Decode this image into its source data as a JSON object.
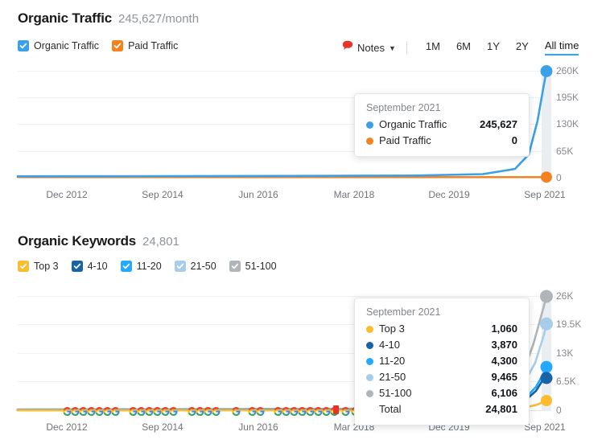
{
  "colors": {
    "organic_traffic": "#3ba0e8",
    "paid_traffic": "#f58220",
    "top3": "#fbbc2e",
    "r4_10": "#1763a6",
    "r11_20": "#25a9ff",
    "r21_50": "#a8cdeb",
    "r51_100": "#b0b5b9",
    "accent": "#25a9ff",
    "notes_red": "#e8352c",
    "grid": "#eef1f3",
    "axis_text": "#85898e"
  },
  "traffic_section": {
    "title": "Organic Traffic",
    "value": "245,627/month",
    "legend": [
      {
        "label": "Organic Traffic",
        "color": "#3ba0e8",
        "checked": true,
        "icon": "checkbox-checked-icon"
      },
      {
        "label": "Paid Traffic",
        "color": "#f58220",
        "checked": true,
        "icon": "checkbox-checked-icon"
      }
    ],
    "controls": {
      "notes_label": "Notes",
      "notes_icon": "speech-bubble-icon",
      "chevron_icon": "chevron-down-icon",
      "ranges": [
        {
          "label": "1M",
          "active": false
        },
        {
          "label": "6M",
          "active": false
        },
        {
          "label": "1Y",
          "active": false
        },
        {
          "label": "2Y",
          "active": false
        },
        {
          "label": "All time",
          "active": true
        }
      ]
    },
    "tooltip": {
      "date": "September 2021",
      "rows": [
        {
          "name": "Organic Traffic",
          "value": "245,627",
          "color": "#3ba0e8"
        },
        {
          "name": "Paid Traffic",
          "value": "0",
          "color": "#f58220"
        }
      ]
    }
  },
  "keywords_section": {
    "title": "Organic Keywords",
    "value": "24,801",
    "legend": [
      {
        "label": "Top 3",
        "color": "#fbbc2e",
        "checked": true,
        "icon": "checkbox-checked-icon"
      },
      {
        "label": "4-10",
        "color": "#1763a6",
        "checked": true,
        "icon": "checkbox-checked-icon"
      },
      {
        "label": "11-20",
        "color": "#25a9ff",
        "checked": true,
        "icon": "checkbox-checked-icon"
      },
      {
        "label": "21-50",
        "color": "#a8cdeb",
        "checked": true,
        "icon": "checkbox-checked-icon"
      },
      {
        "label": "51-100",
        "color": "#b0b5b9",
        "checked": true,
        "icon": "checkbox-checked-icon"
      }
    ],
    "tooltip": {
      "date": "September 2021",
      "rows": [
        {
          "name": "Top 3",
          "value": "1,060",
          "color": "#fbbc2e"
        },
        {
          "name": "4-10",
          "value": "3,870",
          "color": "#1763a6"
        },
        {
          "name": "11-20",
          "value": "4,300",
          "color": "#25a9ff"
        },
        {
          "name": "21-50",
          "value": "9,465",
          "color": "#a8cdeb"
        },
        {
          "name": "51-100",
          "value": "6,106",
          "color": "#b0b5b9"
        }
      ],
      "total_label": "Total",
      "total_value": "24,801"
    }
  },
  "chart_data": [
    {
      "id": "organic-traffic-chart",
      "type": "line",
      "title": "Organic Traffic",
      "xlabel": "",
      "ylabel": "",
      "ylim": [
        0,
        260000
      ],
      "yticks": [
        0,
        65000,
        130000,
        195000,
        260000
      ],
      "ytick_labels": [
        "0",
        "65K",
        "130K",
        "195K",
        "260K"
      ],
      "xtick_labels": [
        "Dec 2012",
        "Sep 2014",
        "Jun 2016",
        "Mar 2018",
        "Dec 2019",
        "Sep 2021"
      ],
      "grid": true,
      "legend_position": "top-left",
      "highlight_x": "Sep 2021",
      "series": [
        {
          "name": "Organic Traffic",
          "color": "#3ba0e8",
          "x": [
            "Dec 2012",
            "Sep 2014",
            "Jun 2016",
            "Mar 2018",
            "Dec 2019",
            "Jun 2021",
            "Aug 2021",
            "Sep 2021"
          ],
          "values": [
            500,
            600,
            700,
            900,
            1500,
            9000,
            70000,
            245627
          ],
          "end_value": 245627
        },
        {
          "name": "Paid Traffic",
          "color": "#f58220",
          "x": [
            "Dec 2012",
            "Sep 2014",
            "Jun 2016",
            "Mar 2018",
            "Dec 2019",
            "Jun 2021",
            "Aug 2021",
            "Sep 2021"
          ],
          "values": [
            0,
            0,
            0,
            0,
            0,
            0,
            0,
            0
          ],
          "end_value": 0
        }
      ]
    },
    {
      "id": "organic-keywords-chart",
      "type": "line",
      "title": "Organic Keywords",
      "xlabel": "",
      "ylabel": "",
      "ylim": [
        0,
        26000
      ],
      "yticks": [
        0,
        6500,
        13000,
        19500,
        26000
      ],
      "ytick_labels": [
        "0",
        "6.5K",
        "13K",
        "19.5K",
        "26K"
      ],
      "xtick_labels": [
        "Dec 2012",
        "Sep 2014",
        "Jun 2016",
        "Mar 2018",
        "Dec 2019",
        "Sep 2021"
      ],
      "grid": true,
      "legend_position": "top-left",
      "highlight_x": "Sep 2021",
      "series": [
        {
          "name": "Top 3",
          "color": "#fbbc2e",
          "values": [
            5,
            8,
            10,
            14,
            30,
            200,
            1060
          ],
          "end_value": 1060
        },
        {
          "name": "4-10",
          "color": "#1763a6",
          "values": [
            12,
            20,
            26,
            40,
            90,
            700,
            3870
          ],
          "end_value": 3870
        },
        {
          "name": "11-20",
          "color": "#25a9ff",
          "values": [
            14,
            24,
            32,
            50,
            110,
            900,
            4300
          ],
          "end_value": 4300
        },
        {
          "name": "21-50",
          "color": "#a8cdeb",
          "values": [
            30,
            50,
            70,
            110,
            260,
            2100,
            9465
          ],
          "end_value": 9465
        },
        {
          "name": "51-100",
          "color": "#b0b5b9",
          "values": [
            40,
            70,
            95,
            150,
            350,
            2600,
            6106
          ],
          "end_value": 6106
        }
      ],
      "annotations": {
        "google_update_markers_label": "Google algorithm updates",
        "marker_count": 32
      }
    }
  ]
}
